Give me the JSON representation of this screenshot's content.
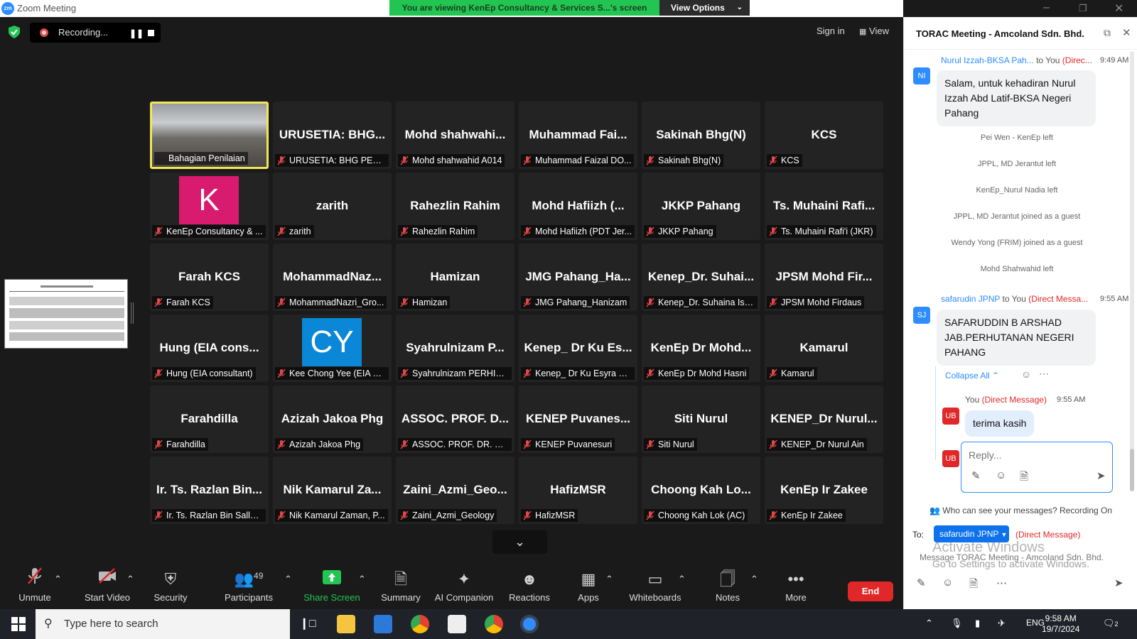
{
  "window": {
    "title": "Zoom Meeting",
    "logo_text": "zm",
    "share_banner": "You are viewing KenEp Consultancy & Services S...'s screen",
    "view_options": "View Options"
  },
  "topbar": {
    "recording_label": "Recording...",
    "sign_in": "Sign in",
    "view": "View"
  },
  "tiles": [
    {
      "big": "",
      "label": "Bahagian Penilaian",
      "video": true
    },
    {
      "big": "URUSETIA: BHG...",
      "label": "URUSETIA: BHG PENIL..."
    },
    {
      "big": "Mohd shahwahi...",
      "label": "Mohd shahwahid A014"
    },
    {
      "big": "Muhammad Fai...",
      "label": "Muhammad Faizal DO..."
    },
    {
      "big": "Sakinah Bhg(N)",
      "label": "Sakinah Bhg(N)"
    },
    {
      "big": "KCS",
      "label": "KCS"
    },
    {
      "big": "",
      "label": "KenEp Consultancy & ...",
      "avatar": "K",
      "avatar_color": "#d81b6e"
    },
    {
      "big": "zarith",
      "label": "zarith"
    },
    {
      "big": "Rahezlin Rahim",
      "label": "Rahezlin Rahim"
    },
    {
      "big": "Mohd Hafiizh (...",
      "label": "Mohd Hafiizh (PDT Jer..."
    },
    {
      "big": "JKKP Pahang",
      "label": "JKKP Pahang"
    },
    {
      "big": "Ts. Muhaini Rafi...",
      "label": "Ts. Muhaini Rafi'i (JKR)"
    },
    {
      "big": "Farah KCS",
      "label": "Farah KCS"
    },
    {
      "big": "MohammadNaz...",
      "label": "MohammadNazri_Gro..."
    },
    {
      "big": "Hamizan",
      "label": "Hamizan"
    },
    {
      "big": "JMG Pahang_Ha...",
      "label": "JMG Pahang_Hanizam"
    },
    {
      "big": "Kenep_Dr. Suhai...",
      "label": "Kenep_Dr. Suhaina Ism..."
    },
    {
      "big": "JPSM Mohd Fir...",
      "label": "JPSM Mohd Firdaus"
    },
    {
      "big": "Hung (EIA cons...",
      "label": "Hung (EIA consultant)"
    },
    {
      "big": "",
      "label": "Kee Chong Yee (EIA Co...",
      "avatar": "CY",
      "avatar_color": "#0a87d6"
    },
    {
      "big": "Syahrulnizam P...",
      "label": "Syahrulnizam PERHILI..."
    },
    {
      "big": "Kenep_ Dr Ku Es...",
      "label": "Kenep_ Dr Ku Esyra Ha..."
    },
    {
      "big": "KenEp Dr Mohd...",
      "label": "KenEp Dr Mohd Hasni"
    },
    {
      "big": "Kamarul",
      "label": "Kamarul"
    },
    {
      "big": "Farahdilla",
      "label": "Farahdilla"
    },
    {
      "big": "Azizah Jakoa Phg",
      "label": "Azizah Jakoa Phg"
    },
    {
      "big": "ASSOC. PROF. D...",
      "label": "ASSOC. PROF. DR. HA..."
    },
    {
      "big": "KENEP Puvanes...",
      "label": "KENEP Puvanesuri"
    },
    {
      "big": "Siti Nurul",
      "label": "Siti Nurul"
    },
    {
      "big": "KENEP_Dr Nurul...",
      "label": "KENEP_Dr Nurul Ain"
    },
    {
      "big": "Ir. Ts. Razlan Bin...",
      "label": "Ir. Ts. Razlan Bin Salleh..."
    },
    {
      "big": "Nik Kamarul Za...",
      "label": "Nik Kamarul Zaman, P..."
    },
    {
      "big": "Zaini_Azmi_Geo...",
      "label": "Zaini_Azmi_Geology"
    },
    {
      "big": "HafizMSR",
      "label": "HafizMSR"
    },
    {
      "big": "Choong Kah Lo...",
      "label": "Choong Kah Lok (AC)"
    },
    {
      "big": "KenEp Ir Zakee",
      "label": "KenEp Ir Zakee"
    }
  ],
  "toolbar": {
    "unmute": "Unmute",
    "start_video": "Start Video",
    "security": "Security",
    "participants": "Participants",
    "participants_count": "49",
    "share_screen": "Share Screen",
    "summary": "Summary",
    "ai_companion": "AI Companion",
    "reactions": "Reactions",
    "apps": "Apps",
    "whiteboards": "Whiteboards",
    "notes": "Notes",
    "more": "More",
    "end": "End"
  },
  "chat": {
    "title": "TORAC Meeting - Amcoland Sdn. Bhd.",
    "msg1": {
      "avatar": "NI",
      "sender": "Nurul Izzah-BKSA Pah...",
      "to": "to You",
      "dm": "(Direc...",
      "time": "9:49 AM",
      "text": "Salam, untuk kehadiran Nurul Izzah Abd Latif-BKSA Negeri Pahang"
    },
    "system": [
      "Pei Wen - KenEp left",
      "JPPL, MD Jerantut left",
      "KenEp_Nurul Nadia left",
      "JPPL, MD Jerantut joined as a guest",
      "Wendy Yong (FRIM) joined as a guest",
      "Mohd Shahwahid left"
    ],
    "msg2": {
      "avatar": "SJ",
      "sender": "safarudin JPNP",
      "to": "to You",
      "dm": "(Direct Messa...",
      "time": "9:55 AM",
      "text": "SAFARUDDIN B ARSHAD JAB.PERHUTANAN NEGERI PAHANG"
    },
    "collapse_all": "Collapse All",
    "reply1": {
      "avatar": "UB",
      "sender": "You",
      "dm": "(Direct Message)",
      "time": "9:55 AM",
      "text": "terima kasih"
    },
    "reply_placeholder": "Reply...",
    "reply_avatar": "UB",
    "who_can_see": "Who can see your messages? Recording On",
    "to_label": "To:",
    "to_select": "safarudin JPNP",
    "dm_label": "(Direct Message)",
    "message_placeholder": "Message TORAC Meeting - Amcoland Sdn. Bhd.",
    "activate_title": "Activate Windows",
    "activate_sub": "Go to Settings to activate Windows."
  },
  "taskbar": {
    "search_placeholder": "Type here to search",
    "lang": "ENG",
    "time": "9:58 AM",
    "date": "19/7/2024",
    "notif_count": "2"
  }
}
